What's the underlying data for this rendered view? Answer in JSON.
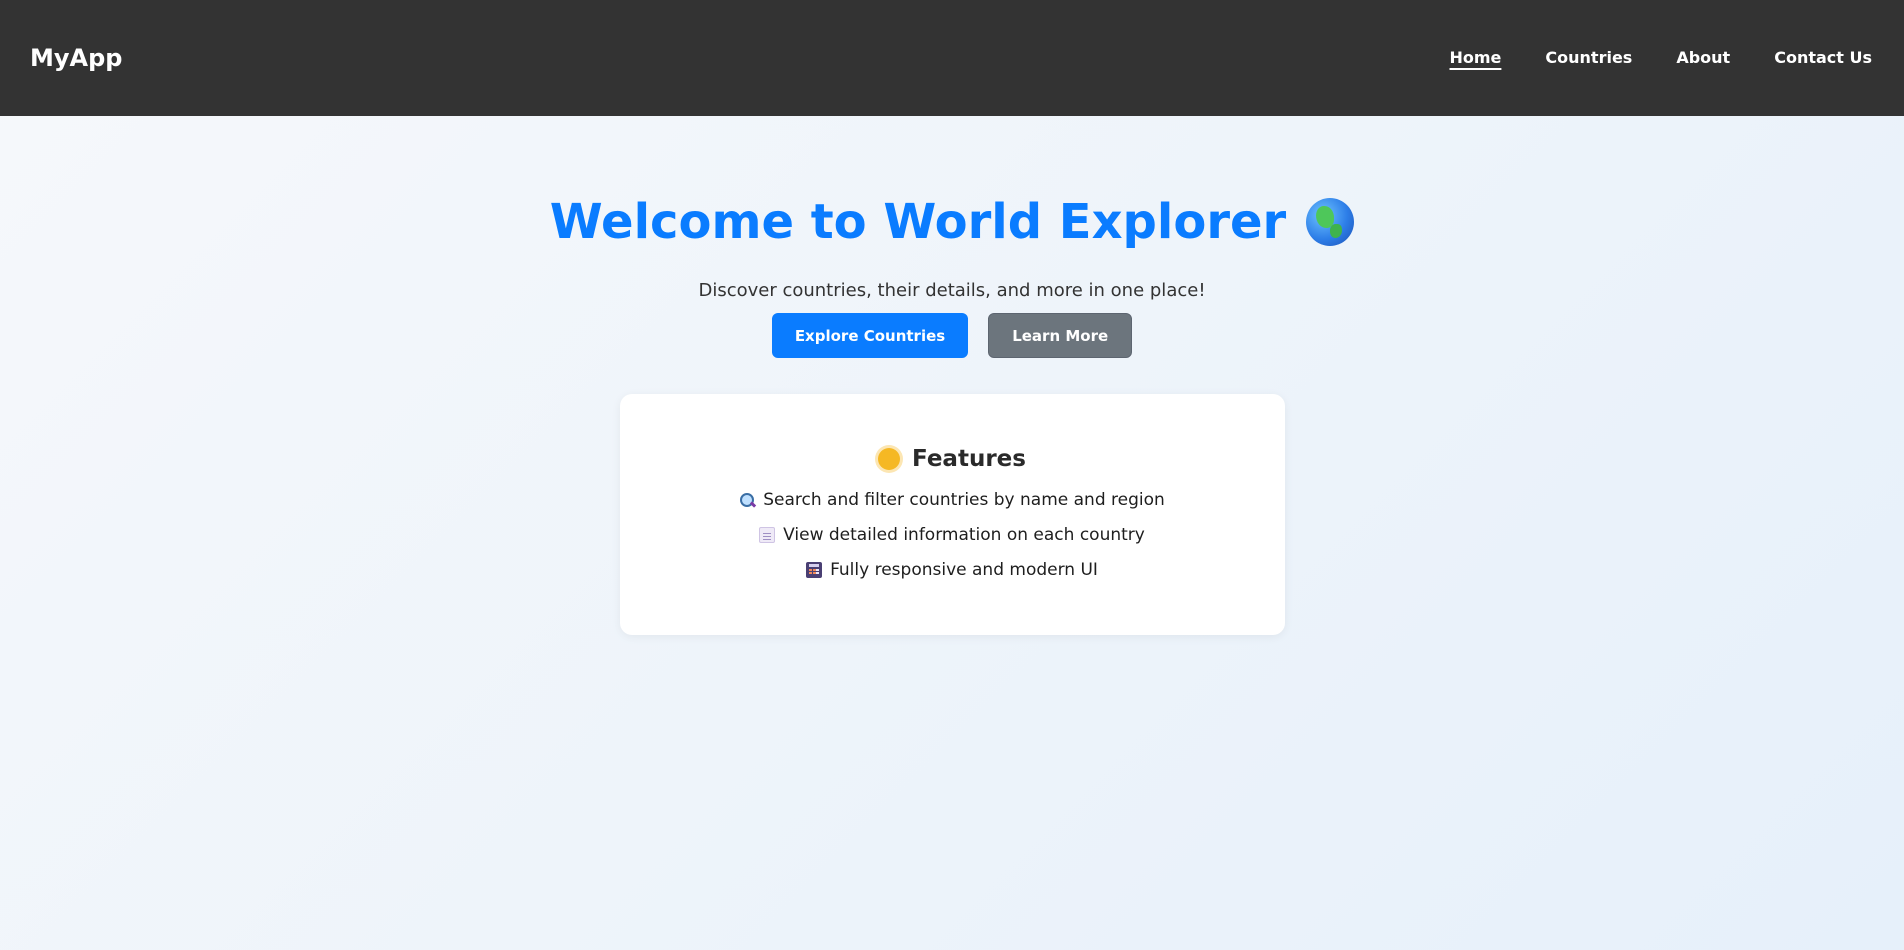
{
  "navbar": {
    "brand": "MyApp",
    "links": [
      {
        "label": "Home",
        "active": true
      },
      {
        "label": "Countries",
        "active": false
      },
      {
        "label": "About",
        "active": false
      },
      {
        "label": "Contact Us",
        "active": false
      }
    ]
  },
  "hero": {
    "title": "Welcome to World Explorer",
    "title_icon": "globe-icon",
    "subtitle": "Discover countries, their details, and more in one place!",
    "primary_button": "Explore Countries",
    "secondary_button": "Learn More"
  },
  "features": {
    "title": "Features",
    "title_icon": "sun-icon",
    "items": [
      {
        "icon": "magnifier-icon",
        "text": "Search and filter countries by name and region"
      },
      {
        "icon": "document-icon",
        "text": "View detailed information on each country"
      },
      {
        "icon": "calculator-icon",
        "text": "Fully responsive and modern UI"
      }
    ]
  },
  "colors": {
    "navbar_bg": "#333333",
    "accent": "#0a7cff",
    "secondary": "#6c757d",
    "card_bg": "#ffffff"
  }
}
